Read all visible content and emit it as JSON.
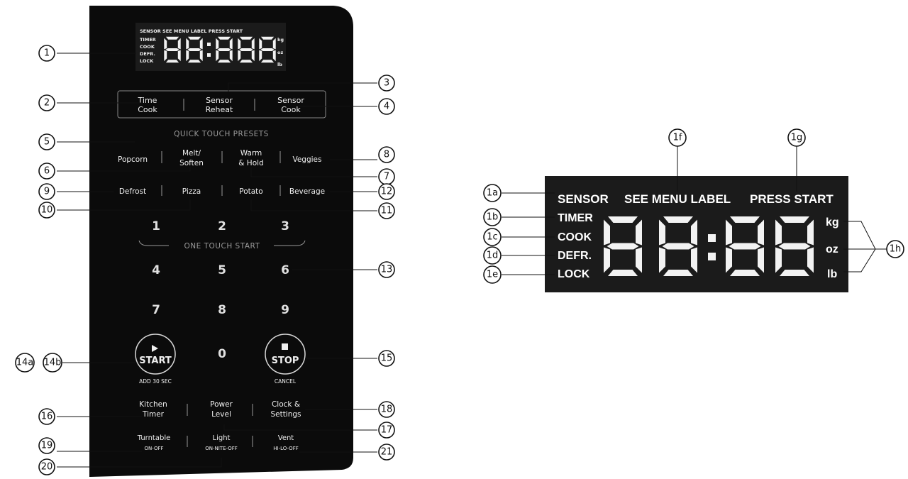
{
  "panel": {
    "display": {
      "indicators_top": "SENSOR  SEE MENU LABEL  PRESS START",
      "indicators_left": [
        "TIMER",
        "COOK",
        "DEFR.",
        "LOCK"
      ],
      "units": [
        "kg",
        "oz",
        "lb"
      ]
    },
    "sensor_row": [
      {
        "line1": "Time",
        "line2": "Cook"
      },
      {
        "line1": "Sensor",
        "line2": "Reheat"
      },
      {
        "line1": "Sensor",
        "line2": "Cook"
      }
    ],
    "presets_heading": "QUICK TOUCH PRESETS",
    "presets_row1": [
      {
        "line1": "Popcorn",
        "line2": ""
      },
      {
        "line1": "Melt/",
        "line2": "Soften"
      },
      {
        "line1": "Warm",
        "line2": "& Hold"
      },
      {
        "line1": "Veggies",
        "line2": ""
      }
    ],
    "presets_row2": [
      "Defrost",
      "Pizza",
      "Potato",
      "Beverage"
    ],
    "keypad": [
      "1",
      "2",
      "3",
      "4",
      "5",
      "6",
      "7",
      "8",
      "9",
      "0"
    ],
    "one_touch_label": "ONE TOUCH START",
    "start_button": {
      "label": "START",
      "sub": "ADD 30 SEC"
    },
    "stop_button": {
      "label": "STOP",
      "sub": "CANCEL"
    },
    "bottom_row1": [
      {
        "line1": "Kitchen",
        "line2": "Timer"
      },
      {
        "line1": "Power",
        "line2": "Level"
      },
      {
        "line1": "Clock &",
        "line2": "Settings"
      }
    ],
    "bottom_row2": [
      {
        "line1": "Turntable",
        "line2": "ON-OFF"
      },
      {
        "line1": "Light",
        "line2": "ON-NITE-OFF"
      },
      {
        "line1": "Vent",
        "line2": "HI-LO-OFF"
      }
    ]
  },
  "callouts_panel": [
    "1",
    "2",
    "3",
    "4",
    "5",
    "6",
    "7",
    "8",
    "9",
    "10",
    "11",
    "12",
    "13",
    "14a",
    "14b",
    "15",
    "16",
    "17",
    "18",
    "19",
    "20",
    "21"
  ],
  "detail_display": {
    "top_labels": [
      "SENSOR",
      "SEE MENU LABEL",
      "PRESS START"
    ],
    "left_labels": [
      "TIMER",
      "COOK",
      "DEFR.",
      "LOCK"
    ],
    "units": [
      "kg",
      "oz",
      "lb"
    ],
    "callouts": [
      "1a",
      "1b",
      "1c",
      "1d",
      "1e",
      "1f",
      "1g",
      "1h"
    ]
  },
  "colors": {
    "panel": "#0b0b0b",
    "text": "#f0f0f0",
    "subtle": "#9a9a9a",
    "lcd": "#1b1b1b"
  }
}
